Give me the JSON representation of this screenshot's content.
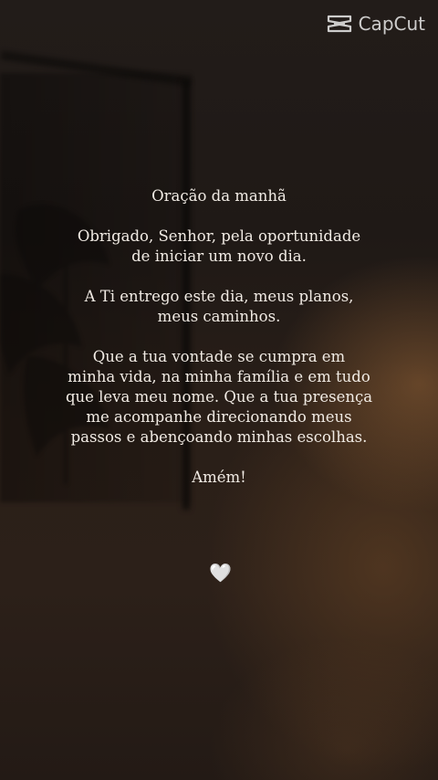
{
  "watermark": {
    "text": "CapCut",
    "icon": "capcut-logo-icon"
  },
  "prayer": {
    "title": "Oração da manhã",
    "paragraph_1": "Obrigado, Senhor, pela oportunidade\nde iniciar um novo dia.",
    "paragraph_2": "A Ti entrego este dia, meus planos,\nmeus caminhos.",
    "paragraph_3": "Que a tua vontade se cumpra em\nminha vida, na minha família e em tudo\nque leva meu nome. Que a tua presença\nme acompanhe direcionando meus\npassos e abençoando minhas escolhas.",
    "closing": "Amém!"
  },
  "decoration": {
    "heart_glyph": "🤍",
    "icon": "white-heart-icon"
  },
  "colors": {
    "text": "#f1ebe4",
    "background": "#1d1816",
    "warm_light": "#96643a"
  }
}
